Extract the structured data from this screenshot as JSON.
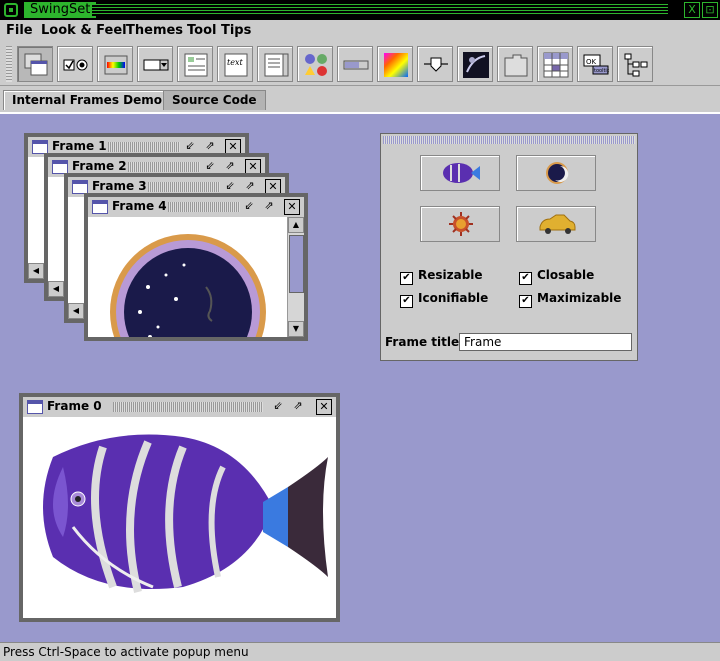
{
  "window": {
    "title": "SwingSet",
    "buttons": [
      "X",
      "⊡"
    ]
  },
  "menu": [
    {
      "label": "File",
      "mnemonic": "F"
    },
    {
      "label": "Look & Feel",
      "mnemonic": "L"
    },
    {
      "label": "Themes",
      "mnemonic": "T"
    },
    {
      "label": "Tool Tips",
      "mnemonic": "o"
    }
  ],
  "toolbar": {
    "icons": [
      "internal-frames-icon",
      "checkbox-radio-icon",
      "filechooser-icon",
      "combobox-icon",
      "layout-icon",
      "text-icon",
      "list-icon",
      "optionpane-icon",
      "progressbar-icon",
      "colorchooser-icon",
      "slider-icon",
      "splitpane-icon",
      "tabbedpane-icon",
      "table-icon",
      "tooltip-icon",
      "tree-icon"
    ],
    "tooltip_button": {
      "ok": "OK",
      "label": "tooltip"
    }
  },
  "tabs": [
    {
      "label": "Internal Frames Demo",
      "selected": true
    },
    {
      "label": "Source Code",
      "selected": false
    }
  ],
  "frames": [
    {
      "title": "Frame 1"
    },
    {
      "title": "Frame 2"
    },
    {
      "title": "Frame 3"
    },
    {
      "title": "Frame 4",
      "image": "moon-image"
    },
    {
      "title": "Frame 0",
      "image": "fish-image"
    }
  ],
  "frame_buttons": {
    "iconify": "⇙",
    "maximize": "⇗",
    "close": "✕"
  },
  "panel": {
    "image_buttons": [
      "fish-icon",
      "moon-icon",
      "sun-icon",
      "cab-icon"
    ],
    "checkboxes": [
      {
        "label": "Resizable",
        "checked": true
      },
      {
        "label": "Closable",
        "checked": true
      },
      {
        "label": "Iconifiable",
        "checked": true
      },
      {
        "label": "Maximizable",
        "checked": true
      }
    ],
    "frame_title_label": "Frame title:",
    "frame_title_value": "Frame"
  },
  "status": "Press Ctrl-Space to activate popup menu",
  "colors": {
    "desktop": "#9999cc",
    "chrome": "#cccccc",
    "accent_green": "#2db52d"
  }
}
